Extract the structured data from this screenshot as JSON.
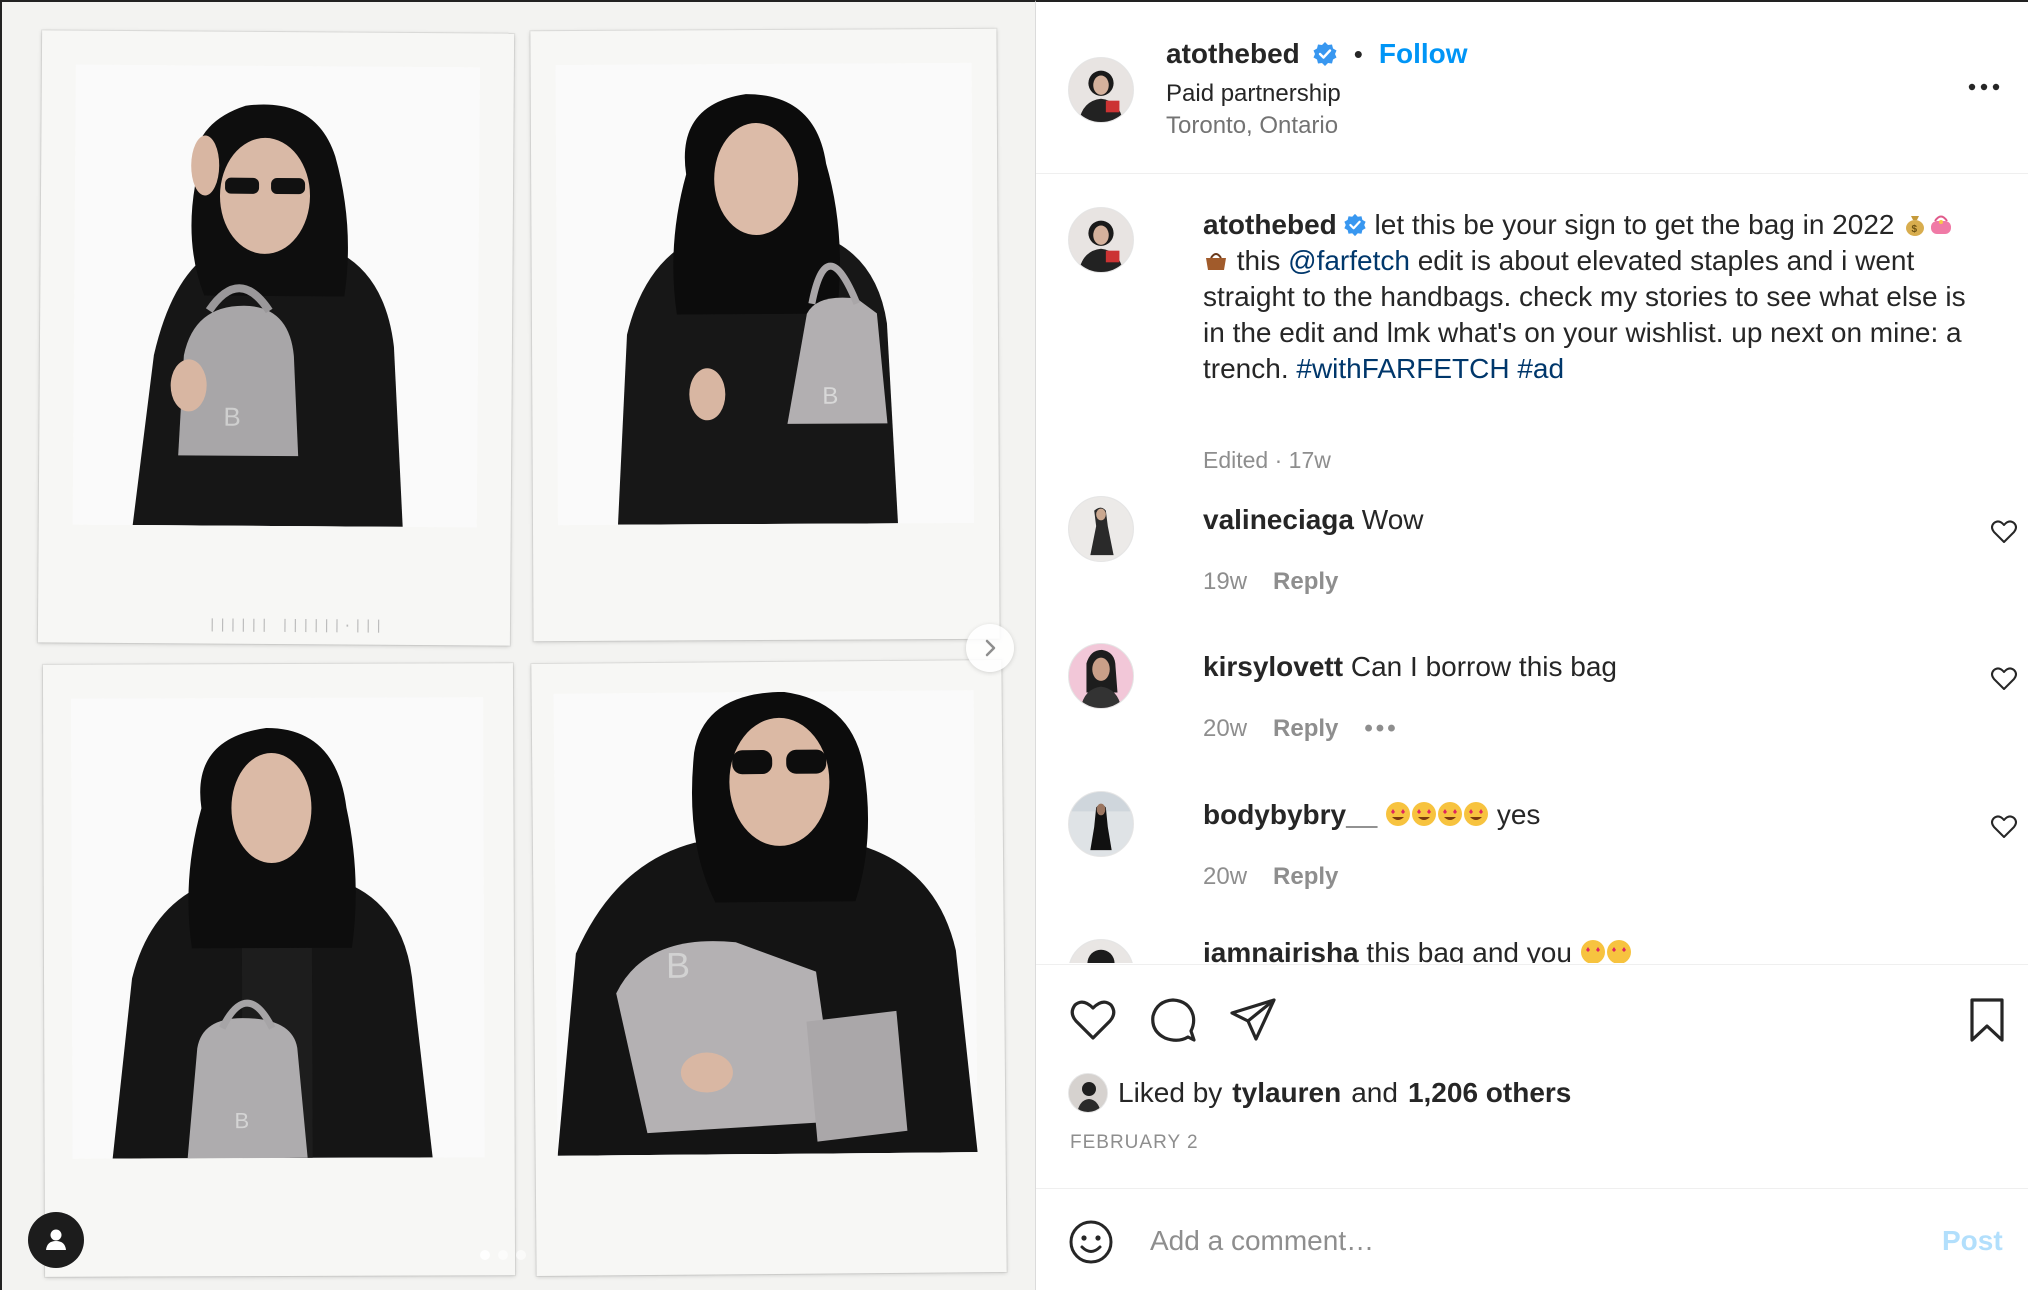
{
  "header": {
    "username": "atothebed",
    "separator": "•",
    "follow_label": "Follow",
    "subtitle": "Paid partnership",
    "location": "Toronto, Ontario"
  },
  "caption": {
    "username": "atothebed",
    "text_part1": " let this be your sign to get the bag in 2022 ",
    "text_part2": " this ",
    "mention": "@farfetch",
    "text_part3": " edit is about elevated staples and i went straight to the handbags. check my stories to see what else is in the edit and lmk what's on your wishlist. up next on mine: a trench. ",
    "hashtag1": "#withFARFETCH",
    "hashtag2": "#ad",
    "meta": "Edited · 17w"
  },
  "comments": [
    {
      "username": "valineciaga",
      "text": "Wow",
      "age": "19w",
      "reply_label": "Reply"
    },
    {
      "username": "kirsylovett",
      "text": "Can I borrow this bag",
      "age": "20w",
      "reply_label": "Reply",
      "more": "•••"
    },
    {
      "username": "bodybybry__",
      "text": "yes",
      "age": "20w",
      "reply_label": "Reply"
    },
    {
      "username": "iamnairisha",
      "text": "this bag and you"
    }
  ],
  "likes": {
    "prefix": "Liked by",
    "user": "tylauren",
    "middle": "and",
    "others": "1,206 others"
  },
  "date": "FEBRUARY 2",
  "comment_box": {
    "placeholder": "Add a comment…",
    "post_label": "Post"
  },
  "colors": {
    "link_blue": "#0095f6",
    "mention_blue": "#00376b",
    "post_disabled": "#b2dffc",
    "muted": "#8e8e8e"
  },
  "icons": [
    "verified-badge-icon",
    "more-options-icon",
    "heart-icon",
    "comment-icon",
    "share-icon",
    "bookmark-icon",
    "smile-icon",
    "chevron-right-icon",
    "user-tag-icon"
  ]
}
